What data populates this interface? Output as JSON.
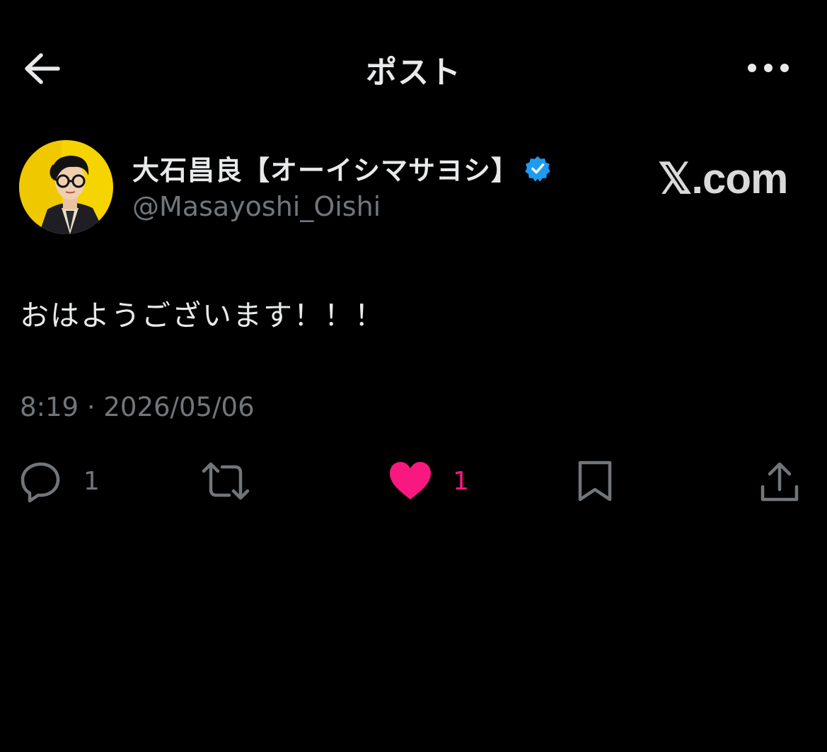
{
  "header": {
    "title": "ポスト",
    "back_icon": "arrow-left-icon",
    "more_icon": "more-horizontal-icon"
  },
  "author": {
    "display_name": "大石昌良【オーイシマサヨシ】",
    "handle": "@Masayoshi_Oishi",
    "verified_icon": "verified-badge-icon",
    "verified_color": "#1d9bf0",
    "avatar_bg_color": "#f5d400"
  },
  "watermark": "𝕏.com",
  "post": {
    "text": "おはようございます！！！",
    "timestamp": "8:19 · 2026/05/06"
  },
  "actions": {
    "reply_count": "1",
    "like_count": "1",
    "like_color": "#f91880",
    "icons": [
      "reply-icon",
      "repost-icon",
      "like-heart-icon",
      "bookmark-icon",
      "share-icon"
    ]
  },
  "colors": {
    "background": "#000000",
    "text_primary": "#e7e9ea",
    "text_secondary": "#71767b"
  }
}
